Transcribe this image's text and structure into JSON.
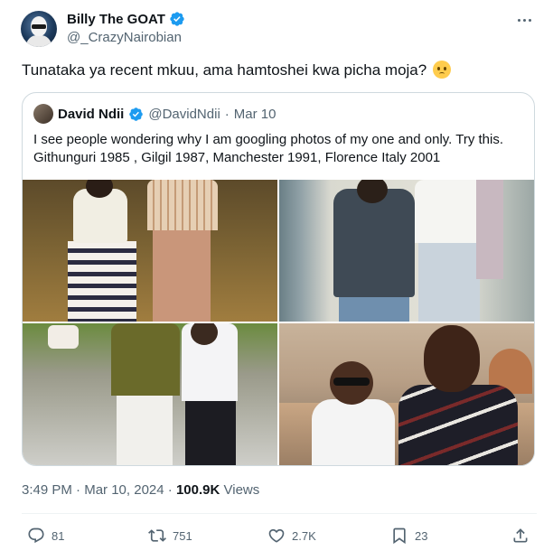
{
  "author": {
    "display_name": "Billy The GOAT",
    "handle": "@_CrazyNairobian"
  },
  "tweet": {
    "text": "Tunataka ya recent mkuu, ama hamtoshei kwa picha moja?",
    "emoji": "pleading-face"
  },
  "quoted": {
    "display_name": "David Ndii",
    "handle": "@DavidNdii",
    "separator": "·",
    "date": "Mar 10",
    "text": "I see people wondering why I am googling photos of my one and only.  Try this. Githunguri 1985 , Gilgil 1987, Manchester 1991, Florence Italy 2001"
  },
  "meta": {
    "time": "3:49 PM",
    "separator": "·",
    "date": "Mar 10, 2024",
    "separator2": "·",
    "views_count": "100.9K",
    "views_label": "Views"
  },
  "actions": {
    "replies": "81",
    "retweets": "751",
    "likes": "2.7K",
    "bookmarks": "23"
  },
  "colors": {
    "verified": "#1d9bf0",
    "secondary_text": "#536471",
    "border": "#cfd9de"
  }
}
